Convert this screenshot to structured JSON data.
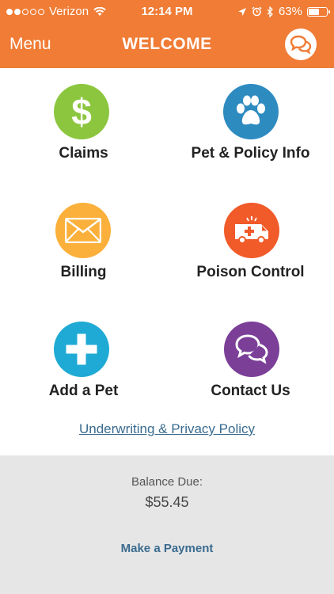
{
  "status_bar": {
    "carrier": "Verizon",
    "time": "12:14 PM",
    "battery": "63%",
    "battery_level": 0.63,
    "signal_bars": 2
  },
  "nav": {
    "menu_label": "Menu",
    "title": "WELCOME",
    "chat_icon": "chat-bubbles-icon"
  },
  "tiles": [
    {
      "label": "Claims",
      "color": "#8cc63f",
      "icon": "dollar-icon"
    },
    {
      "label": "Pet & Policy Info",
      "color": "#2e8bc0",
      "icon": "paw-icon"
    },
    {
      "label": "Billing",
      "color": "#fbb03b",
      "icon": "envelope-icon"
    },
    {
      "label": "Poison Control",
      "color": "#f15a29",
      "icon": "ambulance-icon"
    },
    {
      "label": "Add a Pet",
      "color": "#1eaad4",
      "icon": "plus-icon"
    },
    {
      "label": "Contact Us",
      "color": "#7b3f98",
      "icon": "chat-bubbles-icon"
    }
  ],
  "policy_link": "Underwriting & Privacy Policy",
  "footer": {
    "balance_label": "Balance Due:",
    "balance_amount": "$55.45",
    "payment_link": "Make a Payment"
  },
  "colors": {
    "header": "#f07c35",
    "link": "#3a6b8f",
    "footer_bg": "#e6e6e6"
  }
}
